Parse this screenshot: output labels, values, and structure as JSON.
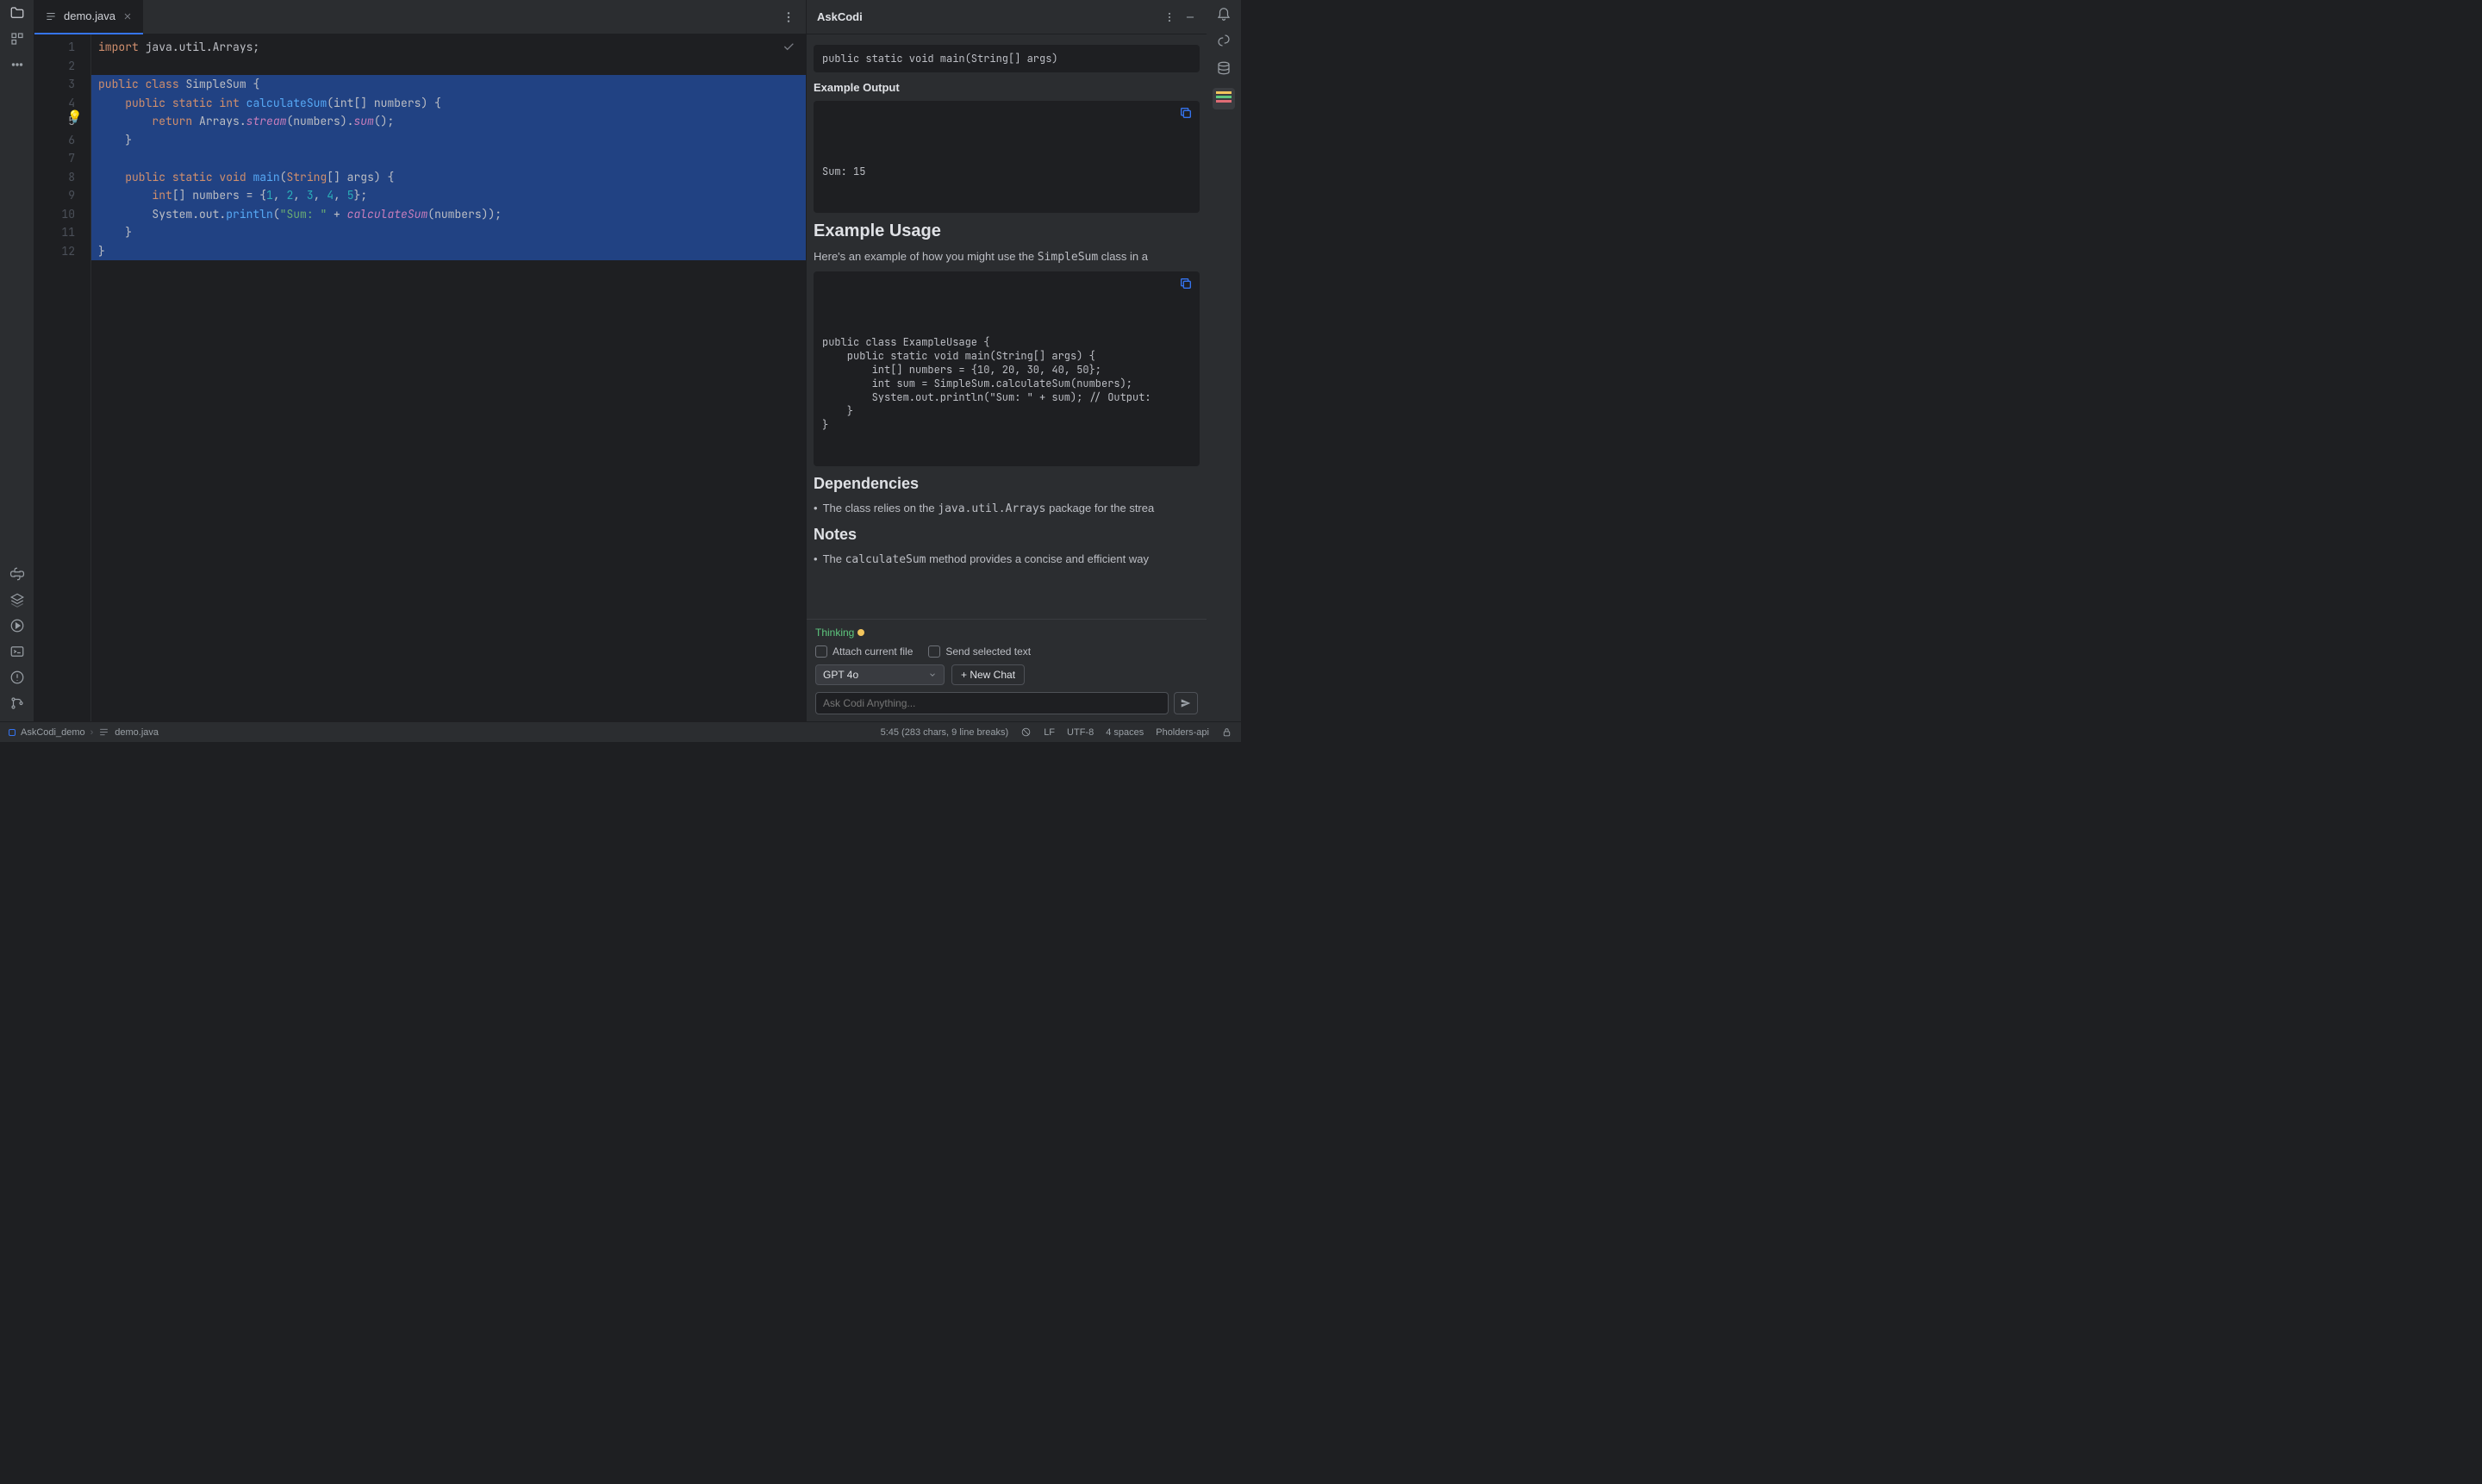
{
  "tab": {
    "filename": "demo.java"
  },
  "gutter": {
    "lines": [
      "1",
      "2",
      "3",
      "4",
      "5",
      "6",
      "7",
      "8",
      "9",
      "10",
      "11",
      "12"
    ],
    "current": 5
  },
  "code": {
    "l1": {
      "import": "import",
      "pkg": " java.util.Arrays;"
    },
    "l3": {
      "pub": "public",
      "cl": "class",
      "name": " SimpleSum ",
      "brace": "{"
    },
    "l4": {
      "indent": "    ",
      "pub": "public",
      "stat": " static",
      "int": " int ",
      "fn": "calculateSum",
      "params": "(int[] numbers) {"
    },
    "l5": {
      "indent": "        ",
      "ret": "return",
      "arr": " Arrays.",
      "stream": "stream",
      "mid": "(numbers).",
      "sum": "sum",
      "end": "();"
    },
    "l6": {
      "indent": "    ",
      "brace": "}"
    },
    "l8": {
      "indent": "    ",
      "pub": "public",
      "stat": " static",
      "void": " void ",
      "main": "main",
      "p1": "(",
      "str": "String",
      "p2": "[] args) {"
    },
    "l9": {
      "indent": "        ",
      "int": "int",
      "decl": "[] numbers = {",
      "n1": "1",
      "c": ", ",
      "n2": "2",
      "n3": "3",
      "n4": "4",
      "n5": "5",
      "end": "};"
    },
    "l10": {
      "indent": "        ",
      "sys": "System.out.",
      "println": "println",
      "p1": "(",
      "s": "\"Sum: \"",
      "plus": " + ",
      "fn": "calculateSum",
      "end": "(numbers));"
    },
    "l11": {
      "indent": "    ",
      "brace": "}"
    },
    "l12": {
      "brace": "}"
    }
  },
  "ask": {
    "title": "AskCodi",
    "sig": "public static void main(String[] args)",
    "example_output_h": "Example Output",
    "example_output": "Sum: 15",
    "example_usage_h": "Example Usage",
    "usage_text_1": "Here's an example of how you might use the ",
    "usage_code_inline": "SimpleSum",
    "usage_text_2": " class in a",
    "usage_block": "public class ExampleUsage {\n    public static void main(String[] args) {\n        int[] numbers = {10, 20, 30, 40, 50};\n        int sum = SimpleSum.calculateSum(numbers);\n        System.out.println(\"Sum: \" + sum); // Output: \n    }\n}",
    "deps_h": "Dependencies",
    "deps_text_1": "The class relies on the ",
    "deps_code": "java.util.Arrays",
    "deps_text_2": " package for the strea",
    "notes_h": "Notes",
    "notes_text_1": "The ",
    "notes_code": "calculateSum",
    "notes_text_2": " method provides a concise and efficient way",
    "thinking": "Thinking",
    "attach": "Attach current file",
    "send_sel": "Send selected text",
    "model": "GPT 4o",
    "new_chat": "+ New Chat",
    "placeholder": "Ask Codi Anything..."
  },
  "status": {
    "project": "AskCodi_demo",
    "file": "demo.java",
    "pos": "5:45 (283 chars, 9 line breaks)",
    "eol": "LF",
    "enc": "UTF-8",
    "indent": "4 spaces",
    "branch": "Pholders-api"
  }
}
